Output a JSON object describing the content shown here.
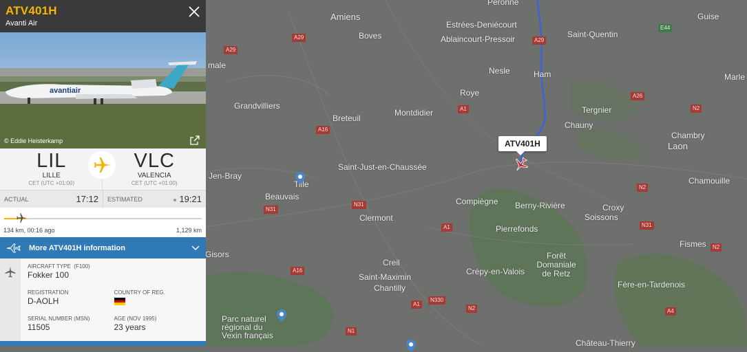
{
  "flight": {
    "callsign": "ATV401H",
    "airline": "Avanti Air",
    "photo_credit": "© Eddie Heisterkamp",
    "aircraft_livery": "avantiair"
  },
  "route": {
    "origin": {
      "code": "LIL",
      "city": "LILLE",
      "tz": "CET (UTC +01:00)"
    },
    "destination": {
      "code": "VLC",
      "city": "VALENCIA",
      "tz": "CET (UTC +01:00)"
    }
  },
  "times": {
    "actual_label": "ACTUAL",
    "actual_value": "17:12",
    "estimated_label": "ESTIMATED",
    "estimated_value": "19:21"
  },
  "progress": {
    "left_text": "134 km, 00:16 ago",
    "right_text": "1,129 km",
    "fraction": 0.11
  },
  "more_info": {
    "label": "More ATV401H information"
  },
  "details": {
    "aircraft_type_label": "AIRCRAFT TYPE",
    "aircraft_type_code": "(F100)",
    "aircraft_type": "Fokker 100",
    "registration_label": "REGISTRATION",
    "registration": "D-AOLH",
    "country_label": "COUNTRY OF REG.",
    "country_flag": "germany-flag",
    "serial_label": "SERIAL NUMBER (MSN)",
    "serial": "11505",
    "age_label": "AGE (NOV 1995)",
    "age": "23 years"
  },
  "map": {
    "flight_tag": "ATV401H",
    "places": [
      "Péronne",
      "Amiens",
      "Estrées-Deniécourt",
      "Boves",
      "Ablaincourt-Pressoir",
      "Saint-Quentin",
      "Guise",
      "Nesle",
      "Ham",
      "Marle",
      "Roye",
      "Montdidier",
      "Tergnier",
      "Breteuil",
      "Grandvilliers",
      "Chauny",
      "Chambry",
      "Laon",
      "Saint-Just-en-Chaussée",
      "Beauvais",
      "Chamouille",
      "Compiègne",
      "Berny-Rivière",
      "Croxy",
      "Soissons",
      "Pierrefonds",
      "Clermont",
      "Fismes",
      "Creil",
      "Forêt Domaniale de Retz",
      "Crépy-en-Valois",
      "Saint-Maximin",
      "Chantilly",
      "Fère-en-Tardenois",
      "Gisors",
      "Parc naturel régional du Vexin français",
      "Château-Thierry",
      "Tille",
      "Jen-Bray",
      "male"
    ],
    "roads": [
      "A29",
      "A29",
      "A29",
      "E44",
      "A26",
      "A1",
      "N2",
      "A16",
      "N31",
      "N2",
      "A1",
      "N31",
      "N31",
      "A16",
      "A1",
      "N330",
      "N2",
      "N2",
      "N1",
      "A4"
    ],
    "colors": {
      "route_line": "#3d63d6",
      "aircraft": "#c0272d",
      "accent": "#f7b500",
      "panel_blue": "#2f79b6"
    }
  }
}
